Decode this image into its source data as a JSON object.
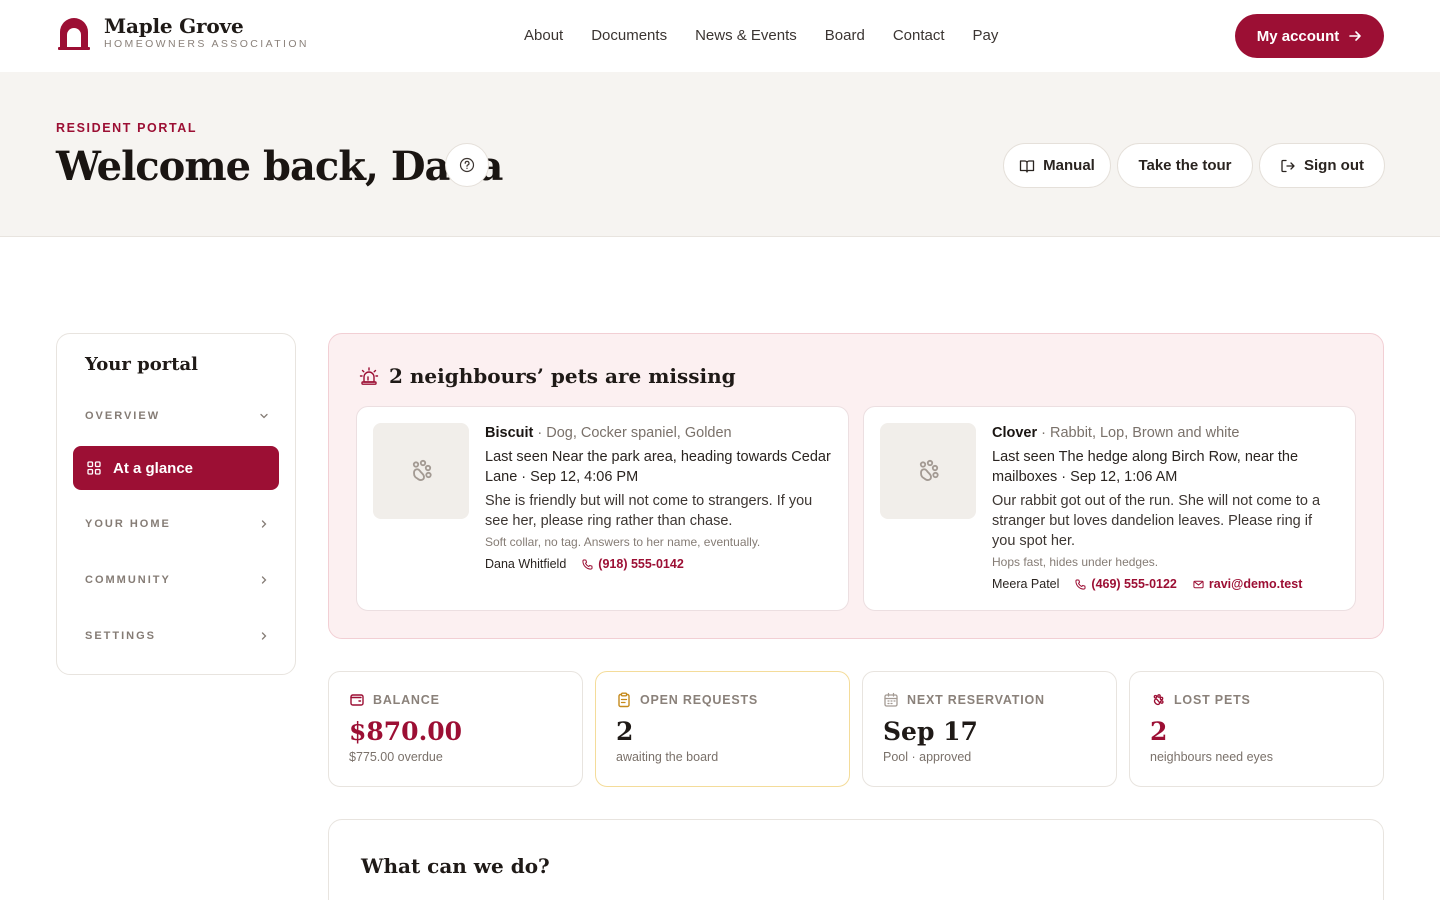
{
  "brand": {
    "name": "Maple Grove",
    "subtitle": "HOMEOWNERS ASSOCIATION",
    "logo_icon": "arch-house-icon",
    "accent": "#9c0f34"
  },
  "nav": {
    "items": [
      "About",
      "Documents",
      "News & Events",
      "Board",
      "Contact",
      "Pay"
    ],
    "account_label": "My account"
  },
  "hero": {
    "eyebrow": "RESIDENT PORTAL",
    "title": "Welcome back, Dana",
    "manual_label": "Manual",
    "tour_label": "Take the tour",
    "signout_label": "Sign out"
  },
  "sidebar": {
    "title": "Your portal",
    "groups": [
      {
        "label": "OVERVIEW",
        "expanded": true
      },
      {
        "label": "YOUR HOME",
        "expanded": false
      },
      {
        "label": "COMMUNITY",
        "expanded": false
      },
      {
        "label": "SETTINGS",
        "expanded": false
      }
    ],
    "active_item": "At a glance"
  },
  "alert": {
    "title": "2 neighbours’ pets are missing",
    "pets": [
      {
        "name": "Biscuit",
        "meta": " · Dog, Cocker spaniel, Golden",
        "seen": "Last seen Near the park area, heading towards Cedar Lane · Sep 12, 4:06 PM",
        "description": "She is friendly but will not come to strangers. If you see her, please ring rather than chase.",
        "note": "Soft collar, no tag. Answers to her name, eventually.",
        "owner": "Dana Whitfield",
        "phone": "(918) 555-0142",
        "email": ""
      },
      {
        "name": "Clover",
        "meta": " · Rabbit, Lop, Brown and white",
        "seen": "Last seen The hedge along Birch Row, near the mailboxes · Sep 12, 1:06 AM",
        "description": "Our rabbit got out of the run. She will not come to a stranger but loves dandelion leaves. Please ring if you spot her.",
        "note": "Hops fast, hides under hedges.",
        "owner": "Meera Patel",
        "phone": "(469) 555-0122",
        "email": "ravi@demo.test"
      }
    ]
  },
  "stats": [
    {
      "label": "BALANCE",
      "value": "$870.00",
      "sub": "$775.00 overdue",
      "icon": "wallet-icon",
      "color": "#9c0f34"
    },
    {
      "label": "OPEN REQUESTS",
      "value": "2",
      "sub": "awaiting the board",
      "icon": "clipboard-icon",
      "color": "#1f1a17"
    },
    {
      "label": "NEXT RESERVATION",
      "value": "Sep 17",
      "sub": "Pool · approved",
      "icon": "calendar-icon",
      "color": "#1f1a17"
    },
    {
      "label": "LOST PETS",
      "value": "2",
      "sub": "neighbours need eyes",
      "icon": "paw-icon",
      "color": "#9c0f34"
    }
  ],
  "bottom": {
    "title": "What can we do?"
  }
}
